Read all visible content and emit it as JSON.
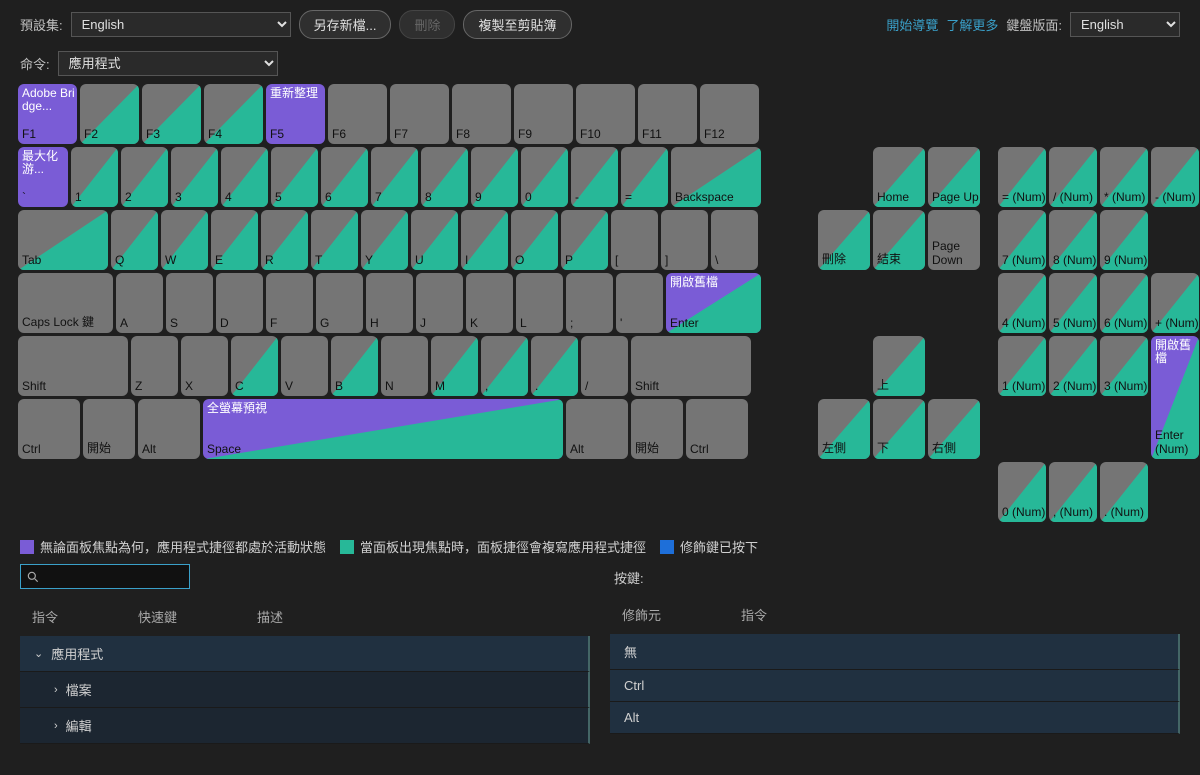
{
  "toolbar": {
    "preset_label": "預設集:",
    "preset_value": "English",
    "save_new": "另存新檔...",
    "delete": "刪除",
    "copy_clip": "複製至剪貼簿",
    "start_tour": "開始導覽",
    "learn_more": "了解更多",
    "kb_layout_label": "鍵盤版面:",
    "kb_layout_value": "English"
  },
  "command_bar": {
    "label": "命令:",
    "value": "應用程式"
  },
  "keys": {
    "adobe_bridge": "Adobe Bridge...",
    "refresh": "重新整理",
    "maximize": "最大化游...",
    "open_old": "開啟舊檔",
    "fullscreen": "全螢幕預視",
    "capslock": "Caps Lock 鍵",
    "backspace": "Backspace",
    "shift": "Shift",
    "ctrl": "Ctrl",
    "start": "開始",
    "alt": "Alt",
    "space": "Space",
    "tab": "Tab",
    "enter": "Enter",
    "home": "Home",
    "pageup": "Page Up",
    "del": "刪除",
    "end": "結束",
    "pagedown": "Page Down",
    "up": "上",
    "left": "左側",
    "down": "下",
    "right": "右側",
    "enter_num": "Enter (Num)",
    "open_old_num": "開啟舊檔",
    "f": [
      "F1",
      "F2",
      "F3",
      "F4",
      "F5",
      "F6",
      "F7",
      "F8",
      "F9",
      "F10",
      "F11",
      "F12"
    ],
    "nums": [
      "`",
      "1",
      "2",
      "3",
      "4",
      "5",
      "6",
      "7",
      "8",
      "9",
      "0",
      "-",
      "="
    ],
    "qwer": [
      "Q",
      "W",
      "E",
      "R",
      "T",
      "Y",
      "U",
      "I",
      "O",
      "P",
      "[",
      "]",
      "\\"
    ],
    "asdf": [
      "A",
      "S",
      "D",
      "F",
      "G",
      "H",
      "J",
      "K",
      "L",
      ";",
      "'"
    ],
    "zxcv": [
      "Z",
      "X",
      "C",
      "V",
      "B",
      "N",
      "M",
      ",",
      ".",
      "/"
    ],
    "numtop": [
      "= (Num)",
      "/ (Num)",
      "* (Num)",
      "- (Num)"
    ],
    "num789": [
      "7 (Num)",
      "8 (Num)",
      "9 (Num)"
    ],
    "num456": [
      "4 (Num)",
      "5 (Num)",
      "6 (Num)",
      "+ (Num)"
    ],
    "num123": [
      "1 (Num)",
      "2 (Num)",
      "3 (Num)"
    ],
    "num0": [
      "0 (Num)",
      ", (Num)",
      ". (Num)"
    ]
  },
  "legend": {
    "purple": "無論面板焦點為何，應用程式捷徑都處於活動狀態",
    "teal": "當面板出現焦點時，面板捷徑會複寫應用程式捷徑",
    "blue": "修飾鍵已按下"
  },
  "bottom": {
    "keypress": "按鍵:",
    "cols_left": [
      "指令",
      "快速鍵",
      "描述"
    ],
    "cols_right": [
      "修飾元",
      "指令"
    ],
    "left_rows": [
      "應用程式",
      "檔案",
      "編輯"
    ],
    "right_rows": [
      "無",
      "Ctrl",
      "Alt"
    ]
  }
}
